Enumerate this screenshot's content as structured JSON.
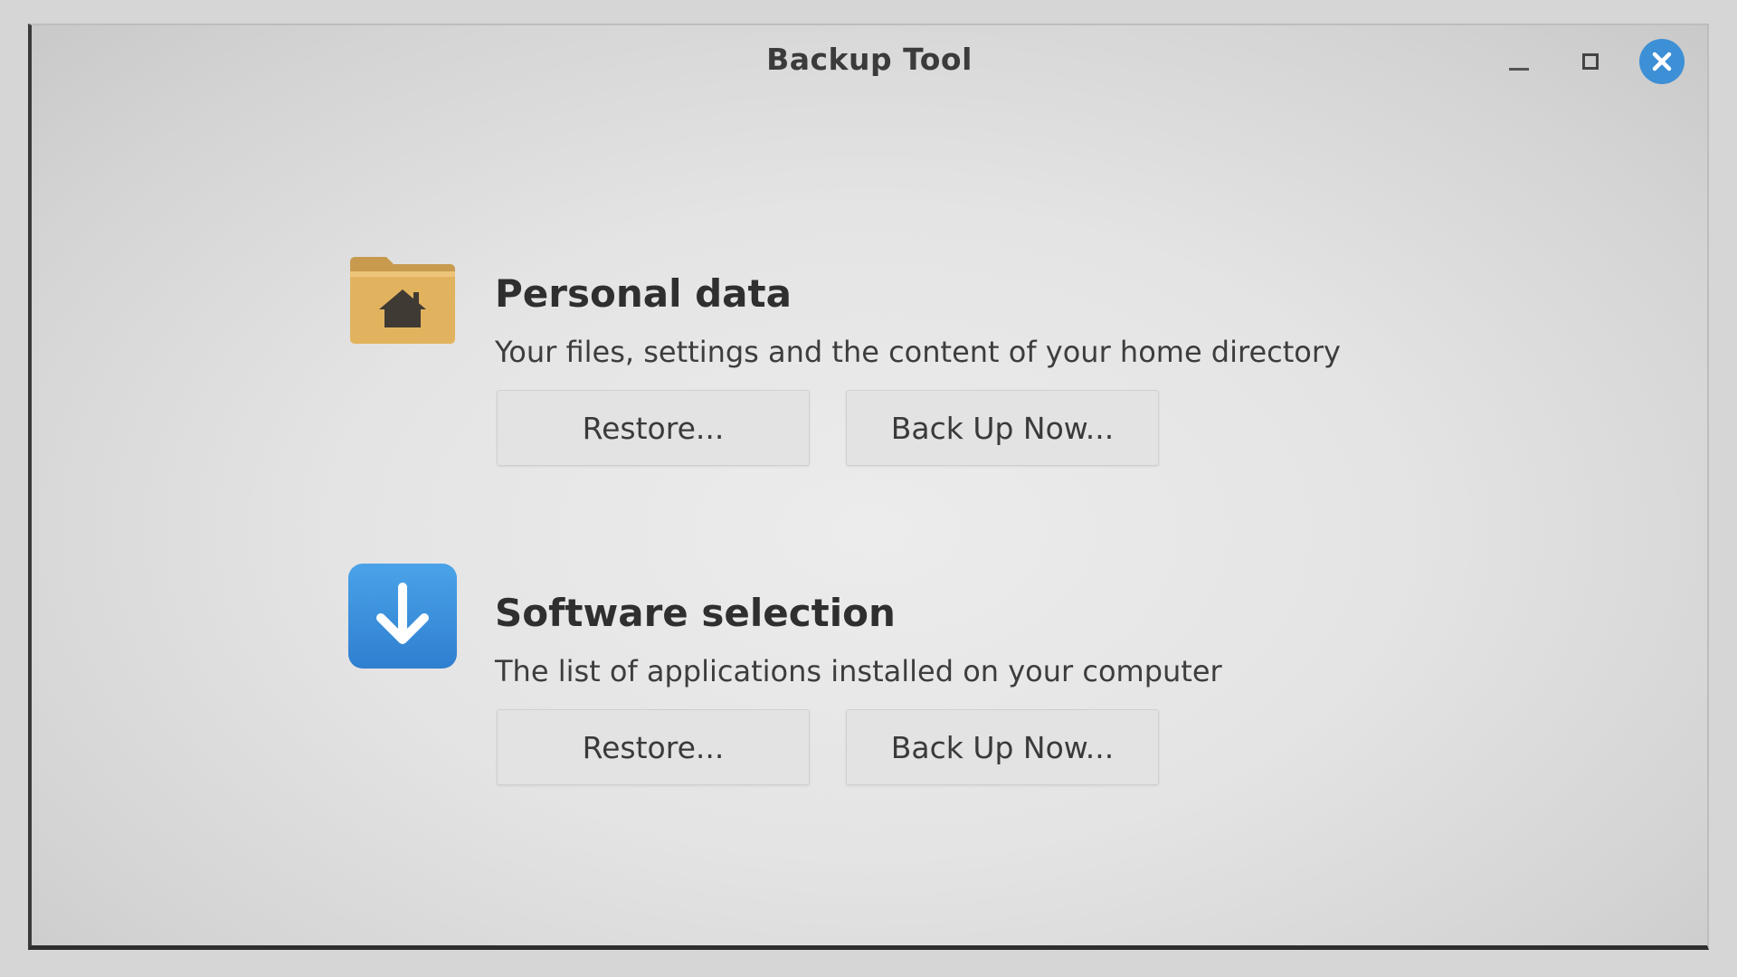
{
  "window": {
    "title": "Backup Tool",
    "controls": {
      "minimize": "minimize-icon",
      "maximize": "maximize-icon",
      "close": "close-icon"
    },
    "accent_color": "#3d8fd6"
  },
  "sections": [
    {
      "icon": "home-folder-icon",
      "heading": "Personal data",
      "description": "Your files, settings and the content of your home directory",
      "restore_label": "Restore...",
      "backup_label": "Back Up Now..."
    },
    {
      "icon": "download-arrow-icon",
      "heading": "Software selection",
      "description": "The list of applications installed on your computer",
      "restore_label": "Restore...",
      "backup_label": "Back Up Now..."
    }
  ]
}
